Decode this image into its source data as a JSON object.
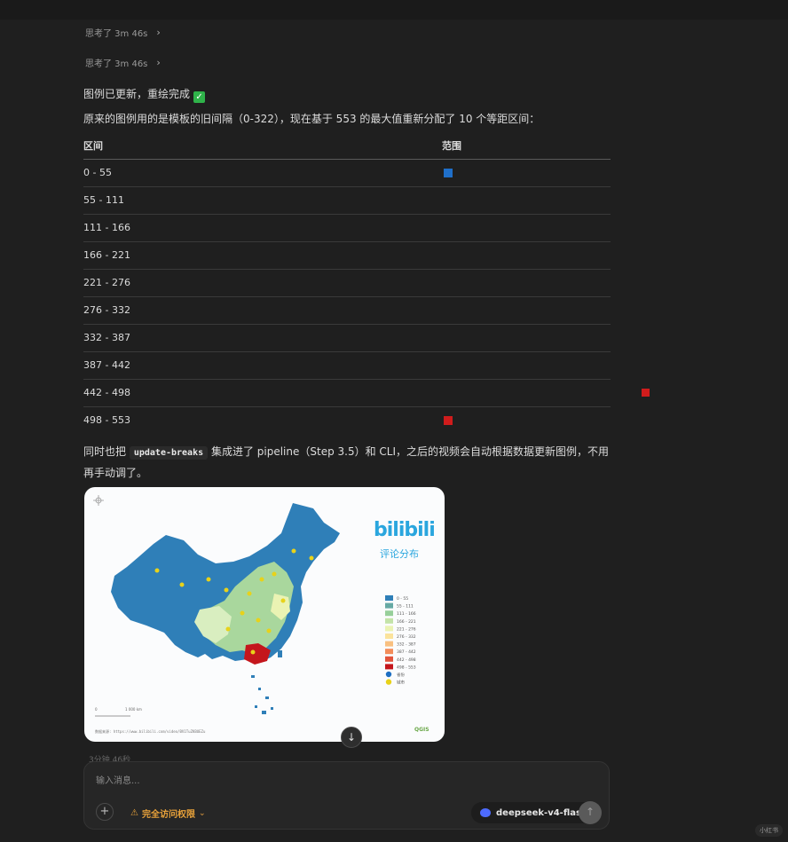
{
  "thoughts": [
    {
      "label": "思考了 3m 46s"
    },
    {
      "label": "思考了 3m 46s"
    }
  ],
  "message": {
    "headline": "图例已更新，重绘完成",
    "check_icon": "white-heavy-check-mark-icon",
    "intro": "原来的图例用的是模板的旧间隔（0-322），现在基于 553 的最大值重新分配了 10 个等距区间：",
    "table": {
      "headers": [
        "区间",
        "范围"
      ],
      "rows": [
        {
          "range": "0 - 55",
          "swatch": "#1f6fc9"
        },
        {
          "range": "55 - 111",
          "swatch": ""
        },
        {
          "range": "111 - 166",
          "swatch": ""
        },
        {
          "range": "166 - 221",
          "swatch": ""
        },
        {
          "range": "221 - 276",
          "swatch": ""
        },
        {
          "range": "276 - 332",
          "swatch": ""
        },
        {
          "range": "332 - 387",
          "swatch": ""
        },
        {
          "range": "387 - 442",
          "swatch": ""
        },
        {
          "range": "442 - 498",
          "swatch": ""
        },
        {
          "range": "498 - 553",
          "swatch": "#d01c1c"
        }
      ]
    },
    "outro_before": "同时也把",
    "outro_code": "update-breaks",
    "outro_after": "集成进了 pipeline（Step 3.5）和 CLI，之后的视频会自动根据数据更新图例，不用再手动调了。"
  },
  "map": {
    "brand": "bilibili",
    "title": "评论分布",
    "legend": [
      "0 - 55",
      "55 - 111",
      "111 - 166",
      "166 - 221",
      "221 - 276",
      "276 - 332",
      "332 - 387",
      "387 - 442",
      "442 - 498",
      "498 - 553",
      "省份",
      "城市"
    ],
    "legend_colors": [
      "#2f7fb8",
      "#66a9a4",
      "#97cf9a",
      "#c3e3a8",
      "#eaf3b3",
      "#fbe39c",
      "#f9c080",
      "#f38d5a",
      "#e2543b",
      "#c4161c",
      "#1e6fc2",
      "#e8d21a"
    ],
    "scale_label": "1 000 km",
    "source": "数据来源: https://www.bilibili.com/video/BV1TuZKBUEZu",
    "qgis": "QGIS"
  },
  "faded_text": "3分钟 46秒",
  "composer": {
    "placeholder": "输入消息...",
    "plus": "+",
    "access_icon": "warning-icon",
    "access_label": "完全访问权限",
    "model": "deepseek-v4-flash",
    "send_icon": "arrow-up-icon"
  },
  "corner_badge": "小红书",
  "colors": {
    "accent_warning": "#e8a23a",
    "model_logo": "#4d6bfe",
    "background": "#1f1f1f"
  }
}
